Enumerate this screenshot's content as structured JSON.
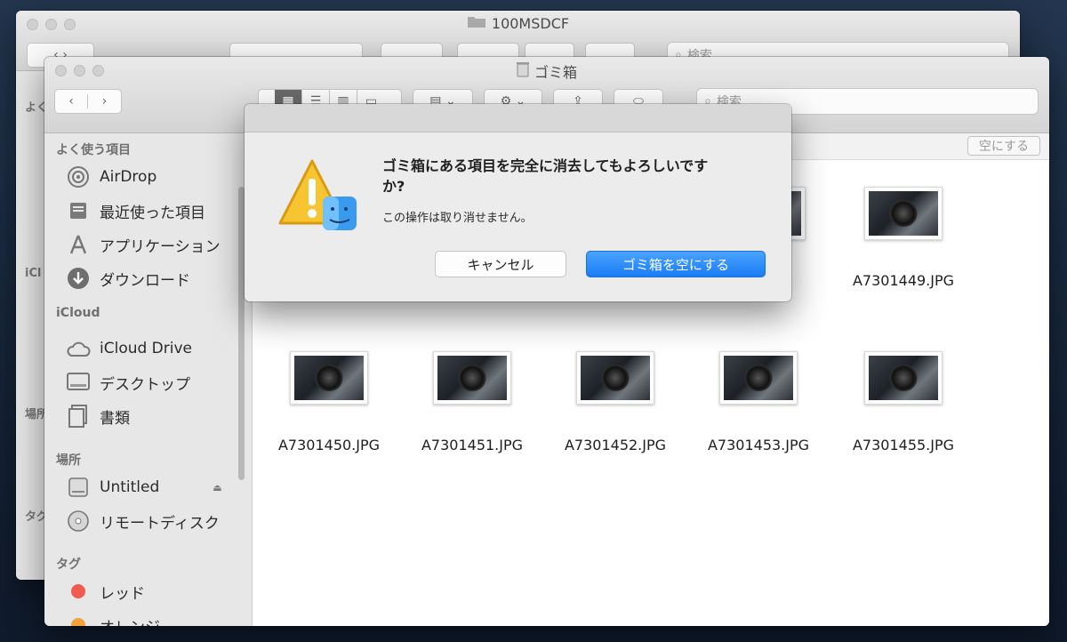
{
  "back_window": {
    "title": "100MSDCF",
    "search_placeholder": "検索",
    "sidebar_fragments": [
      "よく",
      "iCl",
      "場所",
      "タグ"
    ]
  },
  "front_window": {
    "title": "ゴミ箱",
    "search_placeholder": "検索",
    "empty_button": "空にする",
    "sidebar": {
      "favorites_header": "よく使う項目",
      "favorites": [
        {
          "label": "AirDrop",
          "icon": "airdrop-icon"
        },
        {
          "label": "最近使った項目",
          "icon": "recents-icon"
        },
        {
          "label": "アプリケーション",
          "icon": "applications-icon"
        },
        {
          "label": "ダウンロード",
          "icon": "downloads-icon"
        }
      ],
      "icloud_header": "iCloud",
      "icloud": [
        {
          "label": "iCloud Drive",
          "icon": "cloud-icon"
        },
        {
          "label": "デスクトップ",
          "icon": "desktop-icon"
        },
        {
          "label": "書類",
          "icon": "documents-icon"
        }
      ],
      "locations_header": "場所",
      "locations": [
        {
          "label": "Untitled",
          "icon": "disk-icon"
        },
        {
          "label": "リモートディスク",
          "icon": "remote-disc-icon"
        }
      ],
      "tags_header": "タグ",
      "tags": [
        {
          "label": "レッド",
          "color": "#f05a4f"
        },
        {
          "label": "オレンジ",
          "color": "#f5a03a"
        }
      ]
    },
    "files_row1_partial": "PG",
    "files_row1": [
      "A7301449.JPG"
    ],
    "files_row2": [
      "A7301450.JPG",
      "A7301451.JPG",
      "A7301452.JPG",
      "A7301453.JPG",
      "A7301455.JPG"
    ]
  },
  "dialog": {
    "title": "ゴミ箱にある項目を完全に消去してもよろしいですか?",
    "message": "この操作は取り消せません。",
    "cancel_label": "キャンセル",
    "confirm_label": "ゴミ箱を空にする"
  }
}
